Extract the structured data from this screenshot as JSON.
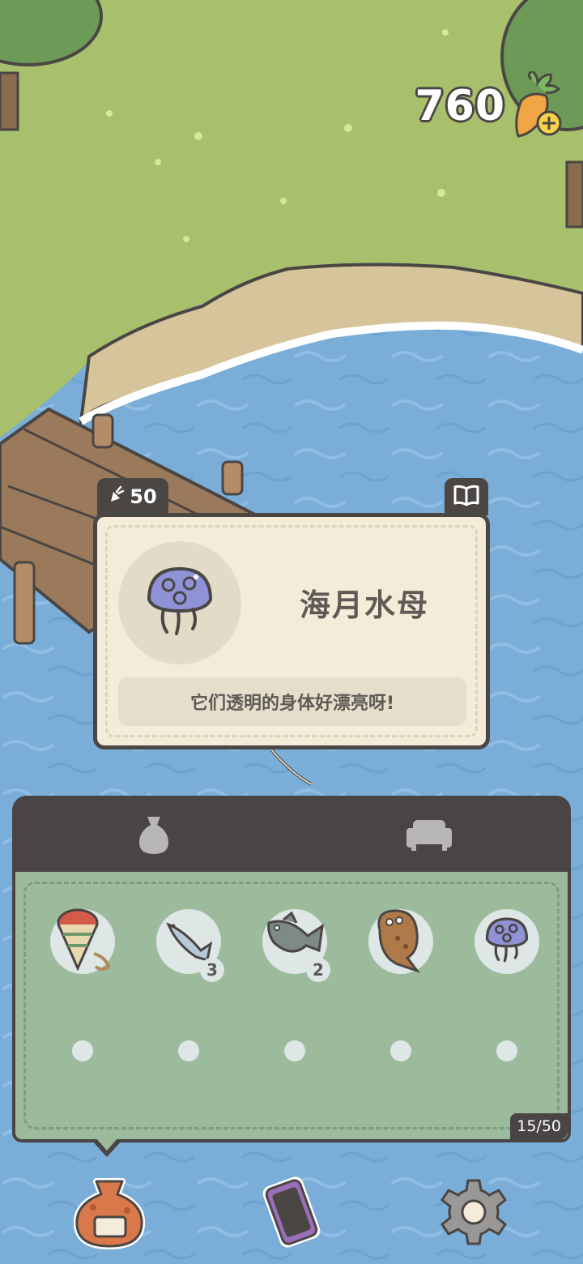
{
  "currency": {
    "amount": "760",
    "icon": "carrot-plus-icon"
  },
  "selected_item": {
    "price": "50",
    "price_icon": "carrot-icon",
    "name": "海月水母",
    "description": "它们透明的身体好漂亮呀!",
    "icon": "moon-jellyfish-icon",
    "encyclopedia_icon": "book-icon"
  },
  "inventory": {
    "tabs": [
      {
        "name": "bag",
        "icon": "sack-icon",
        "active": true
      },
      {
        "name": "furniture",
        "icon": "sofa-icon",
        "active": false
      }
    ],
    "items": [
      {
        "name": "spinning-top",
        "icon": "spinning-top-icon",
        "count": null
      },
      {
        "name": "small-fish",
        "icon": "small-fish-icon",
        "count": "3"
      },
      {
        "name": "bass",
        "icon": "bass-fish-icon",
        "count": "2"
      },
      {
        "name": "flatfish",
        "icon": "flatfish-icon",
        "count": null
      },
      {
        "name": "moon-jellyfish",
        "icon": "moon-jellyfish-icon",
        "count": null
      }
    ],
    "capacity": "15/50"
  },
  "bottom_nav": [
    {
      "name": "bag",
      "icon": "bag-icon"
    },
    {
      "name": "phone",
      "icon": "phone-icon"
    },
    {
      "name": "settings",
      "icon": "gear-icon"
    }
  ],
  "colors": {
    "water": "#7aaed8",
    "grass": "#a8c06c",
    "panel_dark": "#484544",
    "inventory_green": "#9cbb9d",
    "card_cream": "#f4ecd8"
  }
}
